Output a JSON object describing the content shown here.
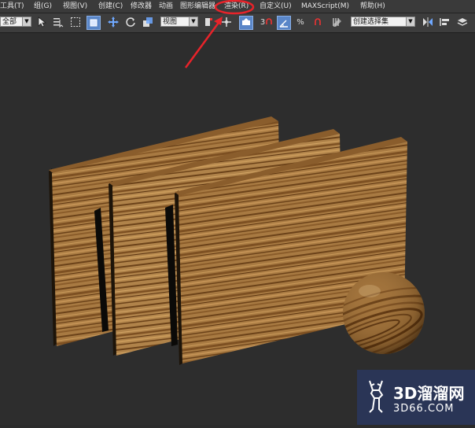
{
  "menubar": {
    "items": [
      {
        "label": "工具(T)"
      },
      {
        "label": "组(G)"
      },
      {
        "label": "视图(V)"
      },
      {
        "label": "创建(C)"
      },
      {
        "label": "修改器"
      },
      {
        "label": "动画"
      },
      {
        "label": "图形编辑器"
      },
      {
        "label": "渲染(R)"
      },
      {
        "label": "自定义(U)"
      },
      {
        "label": "MAXScript(M)"
      },
      {
        "label": "帮助(H)"
      }
    ],
    "highlighted": "渲染(R)"
  },
  "toolbar": {
    "selection_filter": "全部",
    "reference_coord": "视图",
    "named_selection": "创建选择集",
    "snap_number": "3"
  },
  "annotation": {
    "color": "#e8232a"
  },
  "watermark": {
    "title": "3D溜溜网",
    "subtitle": "3D66.COM"
  }
}
